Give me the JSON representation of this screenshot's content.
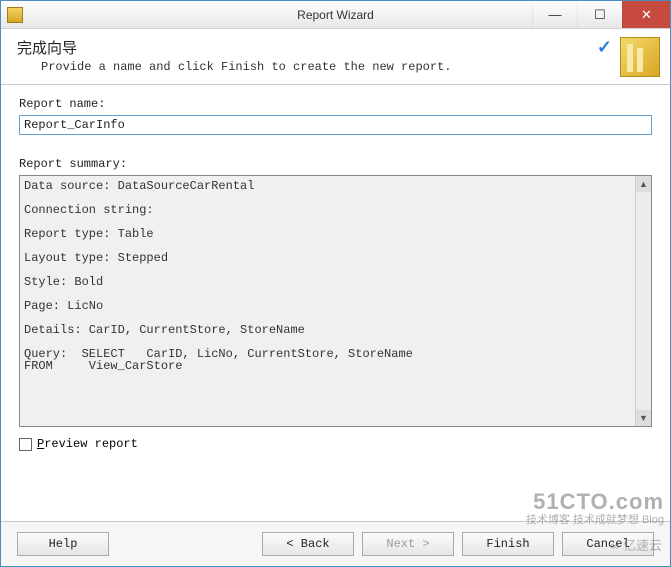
{
  "window": {
    "title": "Report Wizard"
  },
  "header": {
    "title": "完成向导",
    "description": "Provide a name and click Finish to create the new report."
  },
  "form": {
    "name_label": "Report name:",
    "name_value": "Report_CarInfo",
    "summary_label": "Report summary:",
    "summary_text": "Data source: DataSourceCarRental\n\nConnection string:\n\nReport type: Table\n\nLayout type: Stepped\n\nStyle: Bold\n\nPage: LicNo\n\nDetails: CarID, CurrentStore, StoreName\n\nQuery:  SELECT   CarID, LicNo, CurrentStore, StoreName\nFROM     View_CarStore",
    "preview_label": "Preview report",
    "preview_underline": "P"
  },
  "buttons": {
    "help": "Help",
    "back": "< Back",
    "next": "Next >",
    "finish": "Finish",
    "cancel": "Cancel"
  },
  "watermark": {
    "line1": "51CTO.com",
    "line2": "技术博客   技术成就梦想  Blog",
    "tag": "亿速云"
  }
}
